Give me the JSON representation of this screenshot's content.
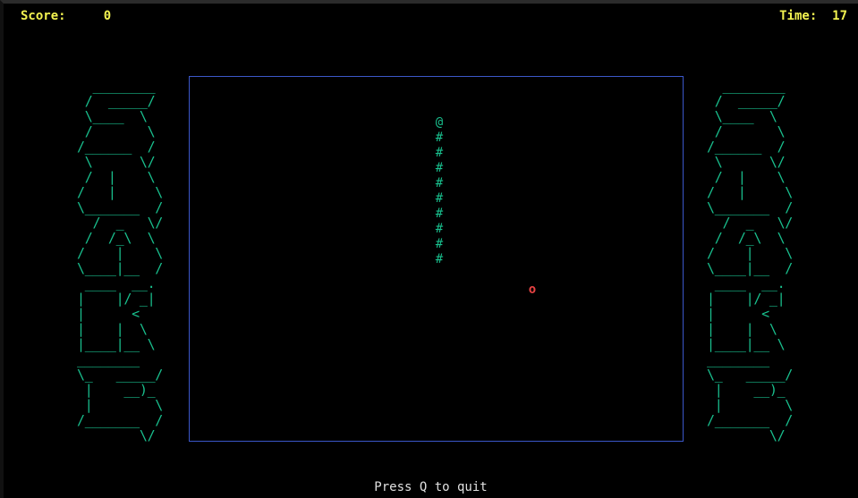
{
  "hud": {
    "score_label": "Score:",
    "score_value": "0",
    "time_label": "Time:",
    "time_value": "17"
  },
  "banner_art": "  ________\n /  _____/\n \\____  \\\n /       \\\n/______  /\n \\      \\/\n /  |    \\\n/   |     \\\n\\_______  /\n  /  _   \\/\n /  /_\\  \\\n/    |    \\\n\\____|__  /\n ____  __.\n|    |/ _|\n|      <\n|    |  \\\n|____|__ \\\n________\n\\_   _____/\n |    __)_\n |        \\\n/_______  /\n        \\/",
  "snake": {
    "head_char": "@",
    "body_char": "#",
    "body_length": 9
  },
  "food": {
    "char": "o"
  },
  "footer": {
    "text": "Press Q to quit"
  },
  "colors": {
    "background": "#000000",
    "hud_text": "#f2f250",
    "snake": "#19c08e",
    "food": "#e84343",
    "board_border": "#3b57c9",
    "footer_text": "#e0e0e0"
  }
}
